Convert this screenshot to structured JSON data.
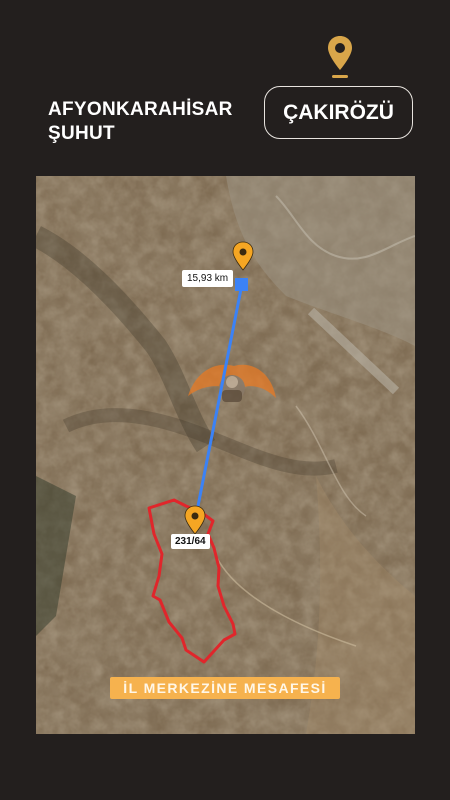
{
  "header": {
    "province": "AFYONKARAHİSAR",
    "district": "ŞUHUT",
    "village": "ÇAKIRÖZÜ",
    "pin_icon": "location-pin-icon",
    "accent_color": "#d9a64a"
  },
  "map": {
    "distance_label": "15,93 km",
    "parcel_label": "231/64",
    "caption": "İL MERKEZİNE MESAFESİ",
    "route_color": "#3b82f6",
    "parcel_border_color": "#e0262b",
    "marker_color": "#f5a623",
    "caption_color": "#f6b24e"
  }
}
